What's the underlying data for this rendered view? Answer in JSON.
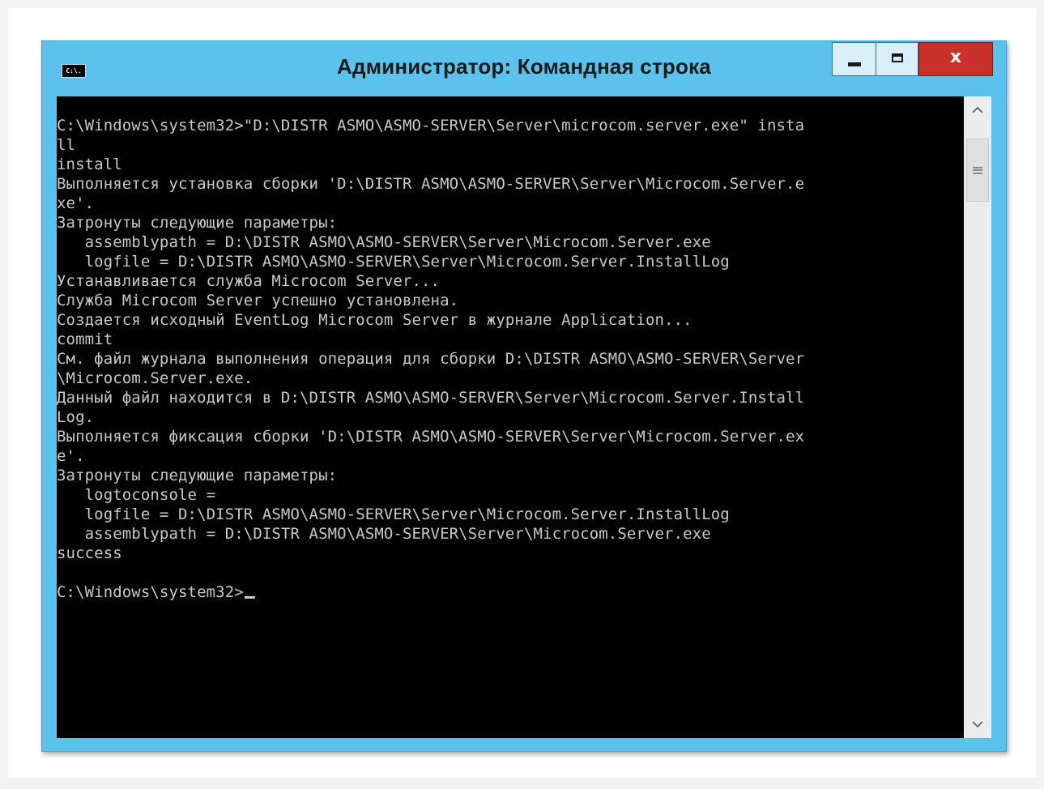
{
  "window": {
    "title": "Администратор: Командная строка",
    "icon_label": "C:\\.",
    "icon": "cmd-app-icon",
    "buttons": {
      "minimize_icon": "minimize-icon",
      "maximize_icon": "maximize-icon",
      "close_icon": "close-icon",
      "close_label": "x"
    },
    "colors": {
      "frame": "#5bc2eb",
      "close_button": "#c9302c",
      "console_background": "#000000",
      "console_text": "#c9c9c9"
    }
  },
  "console": {
    "lines": [
      "C:\\Windows\\system32>\"D:\\DISTR ASMO\\ASMO-SERVER\\Server\\microcom.server.exe\" insta",
      "ll",
      "install",
      "Выполняется установка сборки 'D:\\DISTR ASMO\\ASMO-SERVER\\Server\\Microcom.Server.e",
      "xe'.",
      "Затронуты следующие параметры:",
      "   assemblypath = D:\\DISTR ASMO\\ASMO-SERVER\\Server\\Microcom.Server.exe",
      "   logfile = D:\\DISTR ASMO\\ASMO-SERVER\\Server\\Microcom.Server.InstallLog",
      "Устанавливается служба Microcom Server...",
      "Служба Microcom Server успешно установлена.",
      "Создается исходный EventLog Microcom Server в журнале Application...",
      "commit",
      "См. файл журнала выполнения операция для сборки D:\\DISTR ASMO\\ASMO-SERVER\\Server",
      "\\Microcom.Server.exe.",
      "Данный файл находится в D:\\DISTR ASMO\\ASMO-SERVER\\Server\\Microcom.Server.Install",
      "Log.",
      "Выполняется фиксация сборки 'D:\\DISTR ASMO\\ASMO-SERVER\\Server\\Microcom.Server.ex",
      "e'.",
      "Затронуты следующие параметры:",
      "   logtoconsole =",
      "   logfile = D:\\DISTR ASMO\\ASMO-SERVER\\Server\\Microcom.Server.InstallLog",
      "   assemblypath = D:\\DISTR ASMO\\ASMO-SERVER\\Server\\Microcom.Server.exe",
      "success",
      ""
    ],
    "prompt": "C:\\Windows\\system32>"
  },
  "scrollbar": {
    "up_icon": "scroll-up-arrow-icon",
    "down_icon": "scroll-down-arrow-icon",
    "thumb_grip_icon": "grip-icon"
  }
}
